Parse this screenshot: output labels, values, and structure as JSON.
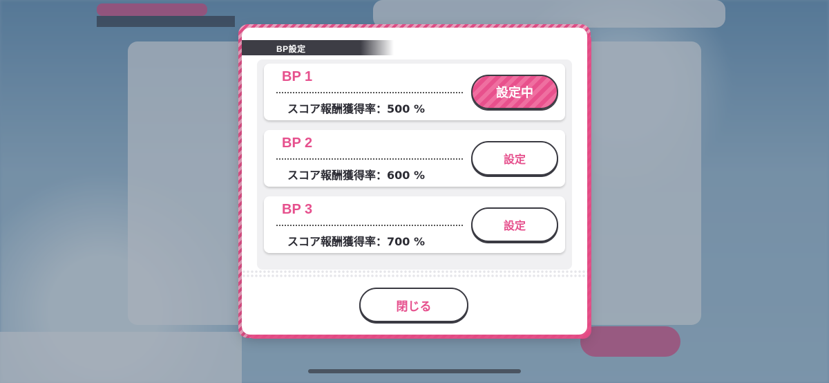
{
  "dialog": {
    "title": "BP設定",
    "close_label": "閉じる"
  },
  "bp_sets": [
    {
      "name": "BP 1",
      "rate_text": "スコア報酬獲得率：500 %",
      "button_label": "設定中",
      "active": true
    },
    {
      "name": "BP 2",
      "rate_text": "スコア報酬獲得率：600 %",
      "button_label": "設定",
      "active": false
    },
    {
      "name": "BP 3",
      "rate_text": "スコア報酬獲得率：700 %",
      "button_label": "設定",
      "active": false
    }
  ],
  "colors": {
    "accent_pink": "#e6508d",
    "dark": "#3a3a42"
  }
}
